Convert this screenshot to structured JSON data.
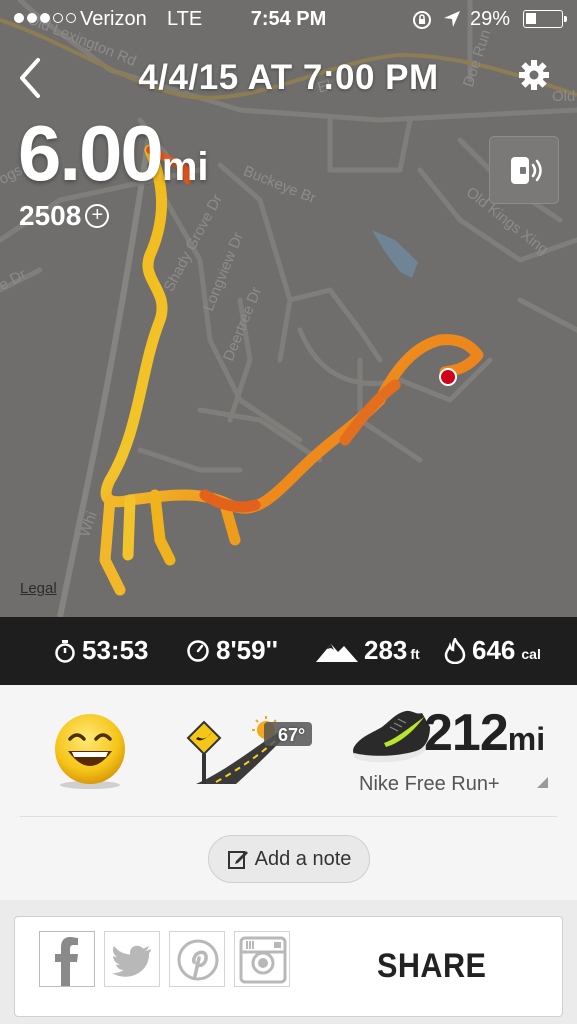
{
  "status_bar": {
    "carrier": "Verizon",
    "network": "LTE",
    "time": "7:54 PM",
    "battery_percent": "29%",
    "battery_level": 0.29,
    "signal_bars_filled": 3,
    "signal_bars_total": 5
  },
  "header": {
    "title": "4/4/15 AT 7:00 PM",
    "back_icon": "chevron-left-icon",
    "settings_icon": "gear-icon"
  },
  "run": {
    "distance": "6.00",
    "distance_unit": "mi",
    "fuel": "2508",
    "audio_icon": "audio-feedback-icon"
  },
  "map": {
    "legal_link": "Legal",
    "streets": [
      "Old Lexington Rd",
      "Doe Run",
      "El",
      "Old",
      "Buckeye Br",
      "Old Kings Xing",
      "Shady Grove Dr",
      "Longview Dr",
      "Deertree Dr",
      "Whi",
      "ogs",
      "e Dr"
    ]
  },
  "stats": {
    "duration": "53:53",
    "pace": "8'59''",
    "elevation": "283",
    "elevation_unit": "ft",
    "calories": "646",
    "calories_unit": "cal"
  },
  "summary": {
    "feeling_icon": "happy-face-icon",
    "terrain_icon": "road-terrain-icon",
    "weather_icon": "sunny-icon",
    "temperature": "67°",
    "shoe_miles": "212",
    "shoe_unit": "mi",
    "shoe_name": "Nike Free Run+",
    "add_note": "Add a note"
  },
  "share": {
    "label": "SHARE",
    "networks": [
      "facebook-icon",
      "twitter-icon",
      "pinterest-icon",
      "instagram-icon"
    ]
  },
  "colors": {
    "map_bg": "#6f6e6c",
    "stats_bg": "#1e1e1e",
    "route_start": "#f0c21a",
    "route_mid": "#f08a1a",
    "route_hot": "#e0501a",
    "end_marker": "#d0021b",
    "shoe_accent": "#b8e62a"
  }
}
